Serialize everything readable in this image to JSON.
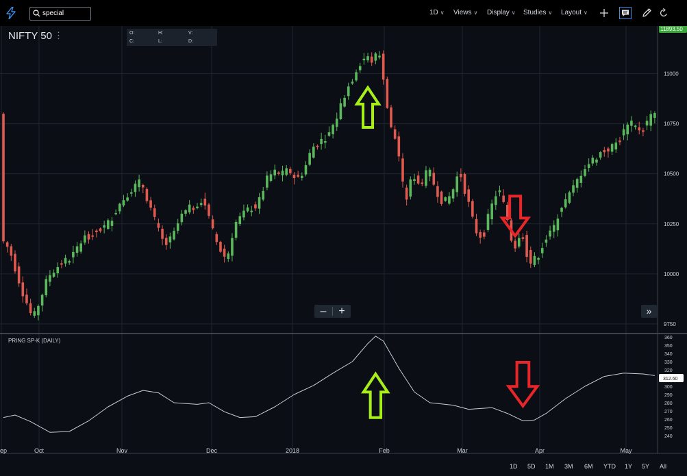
{
  "toolbar": {
    "search_value": "special",
    "menus": [
      {
        "label": "1D",
        "x": 627
      },
      {
        "label": "Views",
        "x": 662
      },
      {
        "label": "Display",
        "x": 711
      },
      {
        "label": "Studies",
        "x": 764
      },
      {
        "label": "Layout",
        "x": 819
      }
    ]
  },
  "symbol": {
    "title": "NIFTY 50"
  },
  "ohlc_labels": {
    "o": "O:",
    "h": "H:",
    "v": "V:",
    "c": "C:",
    "l": "L:",
    "d": "D:"
  },
  "indicator": {
    "label": "PRING SP-K (DAILY)"
  },
  "colors": {
    "up": "#5cb85c",
    "down": "#e05a50",
    "price_tag": "#3aa63a",
    "arrow_up": "#a8ef1a",
    "arrow_down": "#e8262a",
    "line": "#c9ced6"
  },
  "price_tag": "11893.50",
  "indicator_tag": "312.60",
  "range_buttons": [
    "1D",
    "5D",
    "1M",
    "3M",
    "6M",
    "YTD",
    "1Y",
    "5Y",
    "All"
  ],
  "chart_data": {
    "type": "candlestick",
    "price_axis": {
      "ticks": [
        9750,
        10000,
        10250,
        10500,
        10750,
        11000
      ],
      "ylim": [
        9710,
        11255
      ]
    },
    "indicator_axis": {
      "ticks": [
        240,
        250,
        260,
        270,
        280,
        290,
        300,
        310,
        320,
        330,
        340,
        350,
        360
      ],
      "ylim": [
        237,
        362
      ]
    },
    "x_labels": [
      "Sep",
      "Oct",
      "Nov",
      "Dec",
      "2018",
      "Feb",
      "Mar",
      "Apr",
      "May"
    ],
    "price_anchors": [
      [
        0,
        10170
      ],
      [
        2,
        10120
      ],
      [
        5,
        9930
      ],
      [
        8,
        9770
      ],
      [
        10,
        9880
      ],
      [
        12,
        9990
      ],
      [
        15,
        10050
      ],
      [
        18,
        10080
      ],
      [
        21,
        10180
      ],
      [
        24,
        10210
      ],
      [
        27,
        10240
      ],
      [
        30,
        10340
      ],
      [
        33,
        10420
      ],
      [
        36,
        10460
      ],
      [
        38,
        10350
      ],
      [
        40,
        10230
      ],
      [
        42,
        10140
      ],
      [
        44,
        10180
      ],
      [
        46,
        10280
      ],
      [
        48,
        10320
      ],
      [
        50,
        10340
      ],
      [
        52,
        10380
      ],
      [
        54,
        10230
      ],
      [
        56,
        10130
      ],
      [
        58,
        10070
      ],
      [
        60,
        10250
      ],
      [
        62,
        10290
      ],
      [
        64,
        10330
      ],
      [
        66,
        10340
      ],
      [
        68,
        10460
      ],
      [
        70,
        10510
      ],
      [
        72,
        10490
      ],
      [
        74,
        10520
      ],
      [
        76,
        10470
      ],
      [
        78,
        10520
      ],
      [
        80,
        10630
      ],
      [
        82,
        10660
      ],
      [
        84,
        10690
      ],
      [
        86,
        10760
      ],
      [
        88,
        10880
      ],
      [
        90,
        10960
      ],
      [
        92,
        11050
      ],
      [
        94,
        11080
      ],
      [
        96,
        11060
      ],
      [
        97,
        11120
      ],
      [
        98,
        11050
      ],
      [
        100,
        10740
      ],
      [
        102,
        10650
      ],
      [
        104,
        10350
      ],
      [
        106,
        10500
      ],
      [
        108,
        10440
      ],
      [
        110,
        10520
      ],
      [
        112,
        10420
      ],
      [
        114,
        10350
      ],
      [
        116,
        10400
      ],
      [
        118,
        10520
      ],
      [
        120,
        10380
      ],
      [
        122,
        10220
      ],
      [
        124,
        10180
      ],
      [
        126,
        10320
      ],
      [
        128,
        10430
      ],
      [
        130,
        10310
      ],
      [
        132,
        10120
      ],
      [
        134,
        10230
      ],
      [
        136,
        10050
      ],
      [
        138,
        10080
      ],
      [
        140,
        10170
      ],
      [
        142,
        10210
      ],
      [
        144,
        10330
      ],
      [
        146,
        10380
      ],
      [
        148,
        10450
      ],
      [
        150,
        10530
      ],
      [
        152,
        10560
      ],
      [
        154,
        10600
      ],
      [
        156,
        10620
      ],
      [
        158,
        10640
      ],
      [
        160,
        10700
      ],
      [
        162,
        10750
      ],
      [
        164,
        10720
      ],
      [
        166,
        10740
      ],
      [
        168,
        10800
      ]
    ],
    "indicator_anchors": [
      [
        0,
        262
      ],
      [
        3,
        265
      ],
      [
        7,
        257
      ],
      [
        12,
        244
      ],
      [
        17,
        245
      ],
      [
        22,
        258
      ],
      [
        27,
        275
      ],
      [
        32,
        288
      ],
      [
        36,
        295
      ],
      [
        40,
        292
      ],
      [
        44,
        280
      ],
      [
        50,
        278
      ],
      [
        53,
        280
      ],
      [
        57,
        269
      ],
      [
        61,
        262
      ],
      [
        65,
        263
      ],
      [
        70,
        275
      ],
      [
        75,
        290
      ],
      [
        80,
        301
      ],
      [
        85,
        316
      ],
      [
        90,
        330
      ],
      [
        94,
        352
      ],
      [
        96,
        361
      ],
      [
        98,
        355
      ],
      [
        102,
        322
      ],
      [
        106,
        293
      ],
      [
        110,
        280
      ],
      [
        116,
        277
      ],
      [
        120,
        272
      ],
      [
        126,
        274
      ],
      [
        130,
        267
      ],
      [
        134,
        258
      ],
      [
        137,
        259
      ],
      [
        140,
        267
      ],
      [
        145,
        285
      ],
      [
        150,
        300
      ],
      [
        155,
        312
      ],
      [
        160,
        316
      ],
      [
        165,
        315
      ],
      [
        168,
        313
      ]
    ],
    "annotations": [
      {
        "kind": "arrow-up",
        "panel": "price",
        "bar": 94,
        "at": 10930
      },
      {
        "kind": "arrow-down",
        "panel": "price",
        "bar": 132,
        "at": 10190
      },
      {
        "kind": "arrow-up",
        "panel": "indicator",
        "bar": 96,
        "at": 315
      },
      {
        "kind": "arrow-down",
        "panel": "indicator",
        "bar": 134,
        "at": 276
      }
    ]
  }
}
